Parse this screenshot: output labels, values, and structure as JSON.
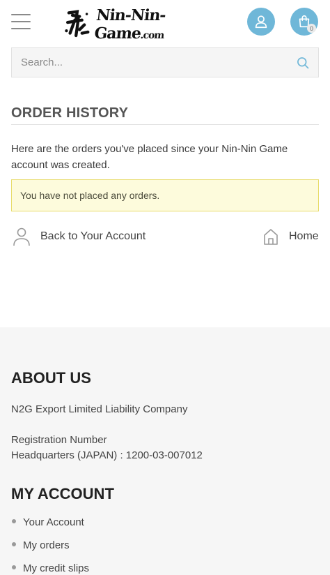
{
  "header": {
    "menu_icon": "hamburger-menu-icon",
    "logo_kanji": "忍",
    "logo_text": "Nin-Nin-Game",
    "logo_suffix": ".com",
    "account_icon": "user-icon",
    "cart_icon": "shopping-bag-icon",
    "cart_count": "0",
    "accent_color": "#6fb7d8"
  },
  "search": {
    "placeholder": "Search...",
    "icon": "search-icon"
  },
  "main": {
    "title": "ORDER HISTORY",
    "intro": "Here are the orders you've placed since your Nin-Nin Game account was created.",
    "alert": "You have not placed any orders.",
    "back_link": "Back to Your Account",
    "home_link": "Home"
  },
  "footer": {
    "about_heading": "ABOUT US",
    "company": "N2G Export Limited Liability Company",
    "reg_label": "Registration Number",
    "reg_value": "Headquarters (JAPAN) : 1200-03-007012",
    "account_heading": "MY ACCOUNT",
    "account_links": [
      "Your Account",
      "My orders",
      "My credit slips"
    ]
  }
}
